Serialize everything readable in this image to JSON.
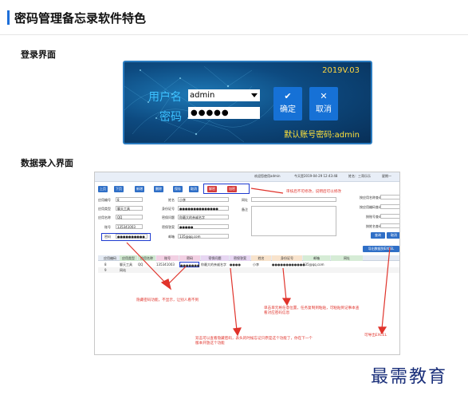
{
  "header": {
    "title": "密码管理备忘录软件特色"
  },
  "sections": {
    "login": "登录界面",
    "entry": "数据录入界面"
  },
  "login": {
    "version": "2019V.03",
    "user_label": "用户名",
    "pass_label": "密码",
    "username": "admin",
    "password": "●●●●●",
    "ok_label": "确定",
    "cancel_label": "取消",
    "default_account": "默认账号密码:admin"
  },
  "app": {
    "topbar": {
      "welcome": "欢迎您使用admin",
      "date": "今天是2019-04-29 12:43:48",
      "weekday": "星期一",
      "user": "姓名：三哥乐乐"
    },
    "toolbar": [
      "上页",
      "下页",
      "新增",
      "删除",
      "保存",
      "取消",
      "解密",
      "加密"
    ],
    "form": {
      "label_name": "应用编号",
      "val_name": "8",
      "label_type": "应用类型",
      "val_type": "聊天工具",
      "label_app": "应用名称",
      "val_app": "QQ",
      "label_acct": "账号",
      "val_acct": "135341003",
      "label_pwd": "密码",
      "val_pwd": "●●●●●●●●●●",
      "label_user": "姓名",
      "val_user": "小李",
      "label_id": "身份证号",
      "val_id": "●●●●●●●●●●●●●●",
      "label_q": "密保问题",
      "val_q": "你最大的亲戚名字",
      "label_ans": "密保答案",
      "val_ans": "●●●●●",
      "label_mail": "邮箱",
      "val_mail": "135@qq.com",
      "label_url": "网址",
      "label_note": "备注"
    },
    "right_panel": {
      "label1": "按应用名称查询",
      "label2": "按应用编码查询",
      "label3": "按账号查询",
      "label4": "按姓名查询",
      "search": "查询",
      "reset": "取消",
      "export": "导出数据到EXCEL"
    },
    "table": {
      "headers": [
        "应用编码",
        "应用类型",
        "应用名称",
        "账号",
        "密码",
        "密保问题",
        "密保答案",
        "姓名",
        "身份证号",
        "邮箱",
        "网址"
      ],
      "rows": [
        [
          "8",
          "聊天工具",
          "QQ",
          "135341003",
          "●●●●●●●",
          "你最大的亲戚名字",
          "●●●●",
          "小李",
          "●●●●●●●●●●●●",
          "135@qq.com",
          ""
        ],
        [
          "9",
          "网站",
          "",
          "",
          "",
          "",
          "",
          "",
          "",
          "",
          ""
        ]
      ]
    }
  },
  "annotations": {
    "a1": "审核后不可修改，说明后可以修改",
    "a2": "隐藏密码功能，不显示，让别人看不到",
    "a3": "单击单元格任意位置，任务复制到粘贴，可粘贴到记事本查看对应密码信息",
    "a4": "双击可以查看隐藏密码，表头的时候忘记只原是这个功能了，你在下一个版本开放这个功能",
    "a5": "可导出EXCEL"
  },
  "watermark": "最需教育",
  "colors": {
    "accent": "#1e6fd9",
    "annotation": "#e0332b",
    "login_bg": "#0d4a80"
  }
}
